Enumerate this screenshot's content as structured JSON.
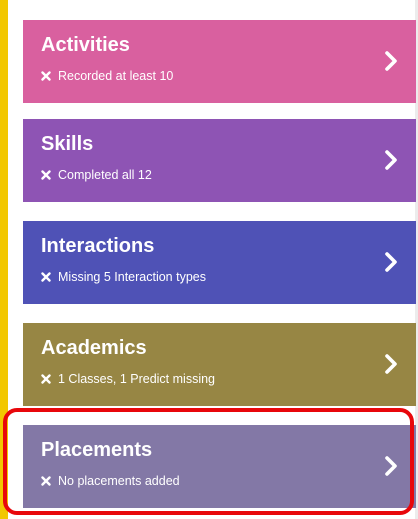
{
  "cards": [
    {
      "title": "Activities",
      "status": "Recorded at least 10",
      "status_icon": "close-icon",
      "color": "#d9609f"
    },
    {
      "title": "Skills",
      "status": "Completed all 12",
      "status_icon": "close-icon",
      "color": "#8e54b4"
    },
    {
      "title": "Interactions",
      "status": "Missing 5 Interaction types",
      "status_icon": "close-icon",
      "color": "#4f52b6"
    },
    {
      "title": "Academics",
      "status": "1 Classes, 1 Predict missing",
      "status_icon": "close-icon",
      "color": "#978644"
    },
    {
      "title": "Placements",
      "status": "No placements added",
      "status_icon": "close-icon",
      "color": "#8378a6",
      "highlighted": true
    }
  ],
  "highlight_color": "#e8070b",
  "frame_accent_color": "#f2c700"
}
